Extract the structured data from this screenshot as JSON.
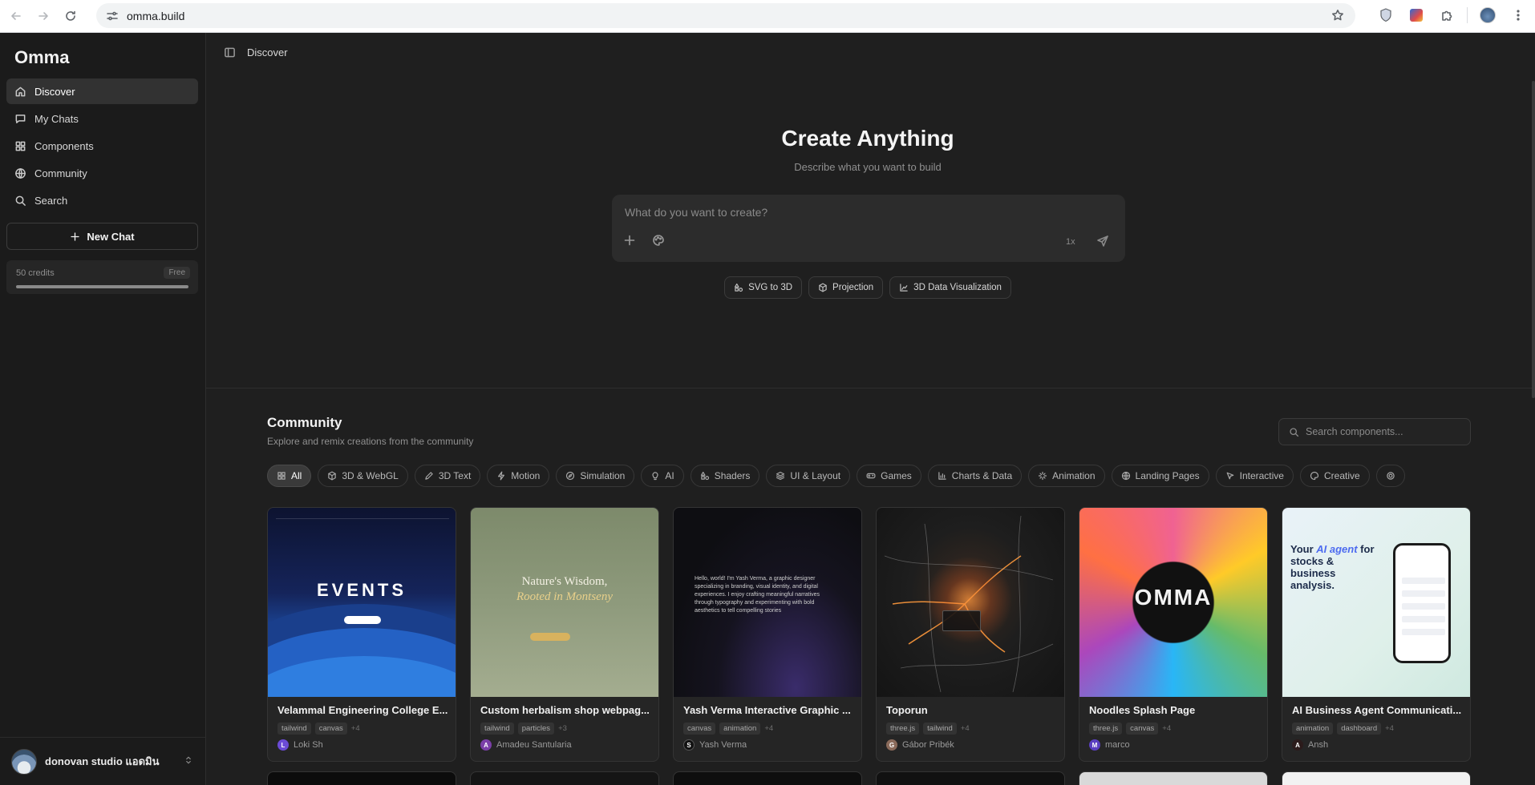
{
  "browser": {
    "url": "omma.build",
    "icons": [
      "back-icon",
      "forward-icon",
      "reload-icon",
      "site-settings-icon",
      "bookmark-star-icon",
      "extension-shield-icon",
      "extension-badge-icon",
      "extensions-puzzle-icon",
      "profile-avatar",
      "kebab-menu-icon"
    ]
  },
  "sidebar": {
    "brand": "Omma",
    "items": [
      {
        "label": "Discover",
        "icon": "home-icon",
        "active": true
      },
      {
        "label": "My Chats",
        "icon": "chat-bubble-icon"
      },
      {
        "label": "Components",
        "icon": "grid-icon"
      },
      {
        "label": "Community",
        "icon": "globe-icon"
      },
      {
        "label": "Search",
        "icon": "search-icon"
      }
    ],
    "new_chat": "New Chat",
    "credits": {
      "label": "50 credits",
      "plan": "Free",
      "progress": 1.0
    },
    "user": {
      "name": "donovan studio แอดมิน"
    }
  },
  "topbar": {
    "breadcrumb": "Discover"
  },
  "hero": {
    "title": "Create Anything",
    "subtitle": "Describe what you want to build",
    "prompt_placeholder": "What do you want to create?",
    "multiplier": "1x",
    "suggestions": [
      {
        "label": "SVG to 3D",
        "icon": "shapes-icon"
      },
      {
        "label": "Projection",
        "icon": "cube-icon"
      },
      {
        "label": "3D Data Visualization",
        "icon": "chart-icon"
      }
    ]
  },
  "community": {
    "title": "Community",
    "subtitle": "Explore and remix creations from the community",
    "search_placeholder": "Search components...",
    "categories": [
      {
        "label": "All",
        "icon": "grid-icon",
        "active": true
      },
      {
        "label": "3D & WebGL",
        "icon": "cube-icon"
      },
      {
        "label": "3D Text",
        "icon": "pen-icon"
      },
      {
        "label": "Motion",
        "icon": "bolt-icon"
      },
      {
        "label": "Simulation",
        "icon": "compass-icon"
      },
      {
        "label": "AI",
        "icon": "lightbulb-icon"
      },
      {
        "label": "Shaders",
        "icon": "shapes-icon"
      },
      {
        "label": "UI & Layout",
        "icon": "layers-icon"
      },
      {
        "label": "Games",
        "icon": "gamepad-icon"
      },
      {
        "label": "Charts & Data",
        "icon": "bar-chart-icon"
      },
      {
        "label": "Animation",
        "icon": "sparkle-icon"
      },
      {
        "label": "Landing Pages",
        "icon": "globe-icon"
      },
      {
        "label": "Interactive",
        "icon": "cursor-icon"
      },
      {
        "label": "Creative",
        "icon": "palette-icon"
      }
    ],
    "cards": [
      {
        "title": "Velammal Engineering College E...",
        "tags": [
          "tailwind",
          "canvas"
        ],
        "more": "+4",
        "author": "Loki Sh",
        "initial": "L",
        "avatar_color": "#6b4bd6"
      },
      {
        "title": "Custom herbalism shop webpag...",
        "tags": [
          "tailwind",
          "particles"
        ],
        "more": "+3",
        "author": "Amadeu Santularia",
        "initial": "A",
        "avatar_color": "#7b3fa8"
      },
      {
        "title": "Yash Verma Interactive Graphic ...",
        "tags": [
          "canvas",
          "animation"
        ],
        "more": "+4",
        "author": "Yash Verma",
        "initial": "S",
        "avatar_color": "#111111"
      },
      {
        "title": "Toporun",
        "tags": [
          "three.js",
          "tailwind"
        ],
        "more": "+4",
        "author": "Gábor Pribék",
        "initial": "G",
        "avatar_color": "#8a6a5a"
      },
      {
        "title": "Noodles Splash Page",
        "tags": [
          "three.js",
          "canvas"
        ],
        "more": "+4",
        "author": "marco",
        "initial": "M",
        "avatar_color": "#5a3fc0"
      },
      {
        "title": "AI Business Agent Communicati...",
        "tags": [
          "animation",
          "dashboard"
        ],
        "more": "+4",
        "author": "Ansh",
        "initial": "A",
        "avatar_color": "#2b1b1b"
      }
    ],
    "thumb_text": {
      "events": "EVENTS",
      "nature_1": "Nature's Wisdom,",
      "nature_2": "Rooted in Montseny",
      "yash": "Hello, world! I'm Yash Verma, a graphic designer specializing in branding, visual identity, and digital experiences. I enjoy crafting meaningful narratives through typography and experimenting with bold aesthetics to tell compelling stories",
      "omma": "OMMA",
      "ai_1": "Your ",
      "ai_2": "AI agent",
      "ai_3": " for stocks & business analysis."
    }
  }
}
